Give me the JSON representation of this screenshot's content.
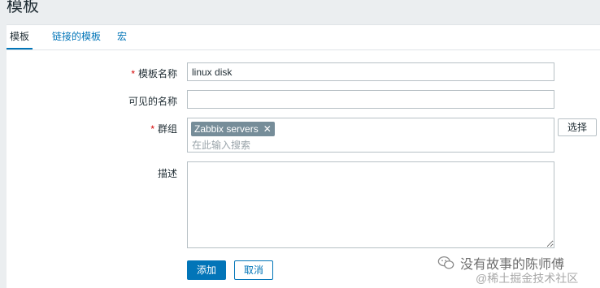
{
  "page": {
    "title": "模板"
  },
  "tabs": [
    {
      "label": "模板"
    },
    {
      "label": "链接的模板"
    },
    {
      "label": "宏"
    }
  ],
  "form": {
    "template_name": {
      "label": "模板名称",
      "value": "linux disk",
      "required_mark": "*"
    },
    "visible_name": {
      "label": "可见的名称",
      "value": ""
    },
    "groups": {
      "label": "群组",
      "required_mark": "*",
      "selected": [
        "Zabbix servers"
      ],
      "remove_symbol": "✕",
      "placeholder": "在此输入搜索",
      "select_button": "选择"
    },
    "description": {
      "label": "描述",
      "value": ""
    }
  },
  "actions": {
    "add": "添加",
    "cancel": "取消"
  },
  "watermark": {
    "text": "没有故事的陈师傅",
    "sub": "@稀土掘金技术社区"
  }
}
